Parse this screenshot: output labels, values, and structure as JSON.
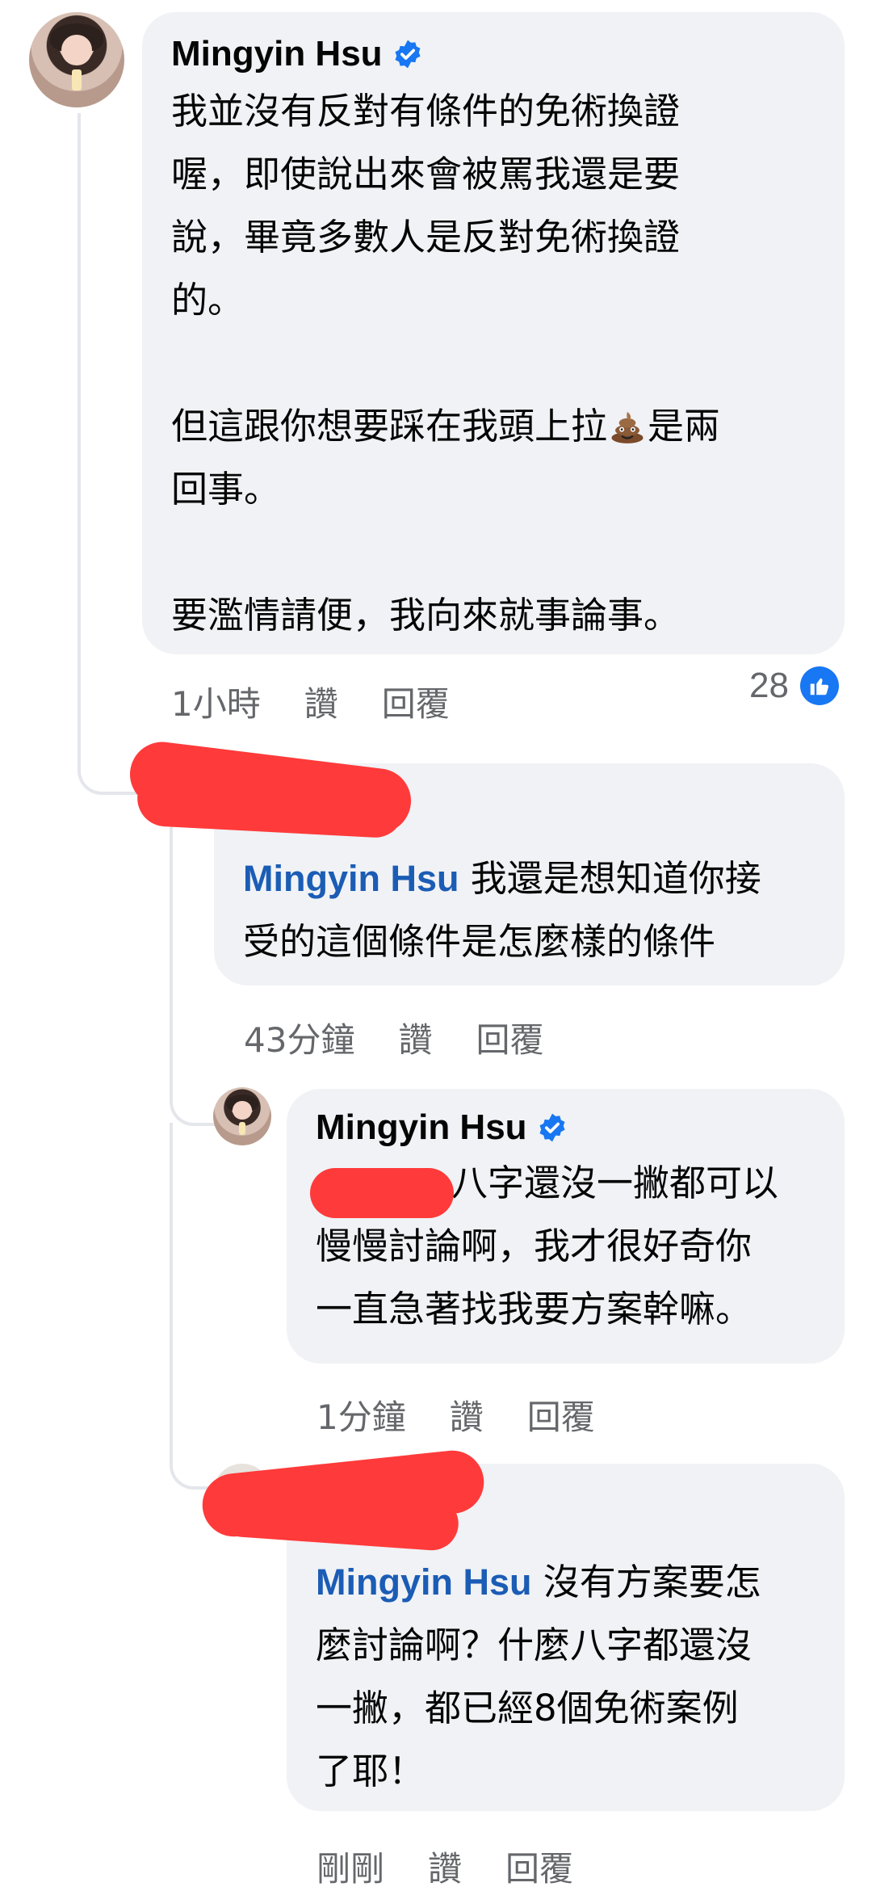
{
  "comments": [
    {
      "author": "Mingyin Hsu",
      "text_1": "我並沒有反對有條件的免術換證\n喔，即使說出來會被罵我還是要\n說，畢竟多數人是反對免術換證\n的。\n\n但這跟你想要踩在我頭上拉",
      "emoji": "poop-emoji",
      "text_2": "是兩\n回事。\n\n要濫情請便，我向來就事論事。",
      "time": "1小時",
      "like_label": "讚",
      "reply_label": "回覆",
      "reaction_count": "28"
    },
    {
      "mention": "Mingyin Hsu",
      "text": " 我還是想知道你接\n受的這個條件是怎麼樣的條件",
      "time": "43分鐘",
      "like_label": "讚",
      "reply_label": "回覆"
    },
    {
      "author": "Mingyin Hsu",
      "text": "八字還沒一撇都可以\n慢慢討論啊，我才很好奇你\n一直急著找我要方案幹嘛。",
      "time": "1分鐘",
      "like_label": "讚",
      "reply_label": "回覆"
    },
    {
      "mention": "Mingyin Hsu",
      "text": " 沒有方案要怎\n麼討論啊？什麼八字都還沒\n一撇，都已經8個免術案例\n了耶！",
      "time": "剛剛",
      "like_label": "讚",
      "reply_label": "回覆"
    }
  ],
  "colors": {
    "bubble": "#f0f2f5",
    "mention": "#1b5cb5",
    "meta": "#65676b",
    "like": "#1877f2",
    "verified": "#1877f2",
    "redaction": "#ff3a3a"
  },
  "icons": {
    "verified": "verified-badge-icon",
    "like": "thumbs-up-icon",
    "emoji": "poop-emoji"
  }
}
